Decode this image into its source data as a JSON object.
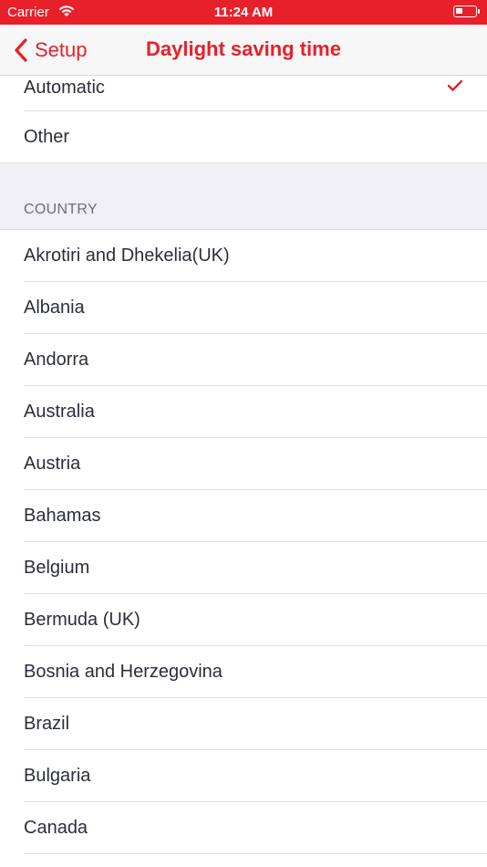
{
  "status_bar": {
    "carrier": "Carrier",
    "time": "11:24 AM",
    "battery_level": 0.35,
    "accent_color": "#e8202a"
  },
  "nav": {
    "back_label": "Setup",
    "title": "Daylight saving time"
  },
  "options": [
    {
      "label": "Automatic",
      "selected": true
    },
    {
      "label": "Other",
      "selected": false
    }
  ],
  "section": {
    "header": "COUNTRY"
  },
  "countries": [
    "Akrotiri and Dhekelia(UK)",
    "Albania",
    "Andorra",
    "Australia",
    "Austria",
    "Bahamas",
    "Belgium",
    "Bermuda (UK)",
    "Bosnia and Herzegovina",
    "Brazil",
    "Bulgaria",
    "Canada"
  ],
  "icons": {
    "back": "chevron-left-icon",
    "check": "checkmark-icon",
    "wifi": "wifi-icon",
    "battery": "battery-icon"
  }
}
